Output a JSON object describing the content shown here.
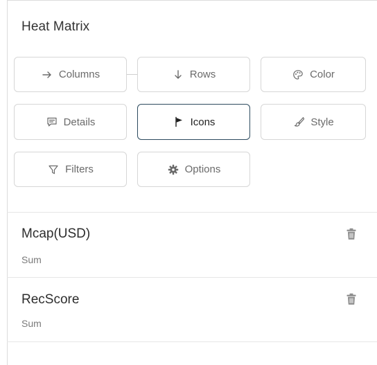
{
  "panel": {
    "title": "Heat Matrix"
  },
  "buttons": {
    "columns": {
      "label": "Columns",
      "icon": "arrow-right-icon"
    },
    "rows": {
      "label": "Rows",
      "icon": "arrow-down-icon"
    },
    "color": {
      "label": "Color",
      "icon": "palette-icon"
    },
    "details": {
      "label": "Details",
      "icon": "comment-icon"
    },
    "icons": {
      "label": "Icons",
      "icon": "flag-icon",
      "active": true
    },
    "style": {
      "label": "Style",
      "icon": "paint-brush-icon"
    },
    "filters": {
      "label": "Filters",
      "icon": "filter-icon"
    },
    "options": {
      "label": "Options",
      "icon": "gear-icon"
    }
  },
  "measures": [
    {
      "name": "Mcap(USD)",
      "aggregation": "Sum"
    },
    {
      "name": "RecScore",
      "aggregation": "Sum"
    }
  ],
  "colors": {
    "active_border": "#2c4a5e",
    "border": "#d6d6d6",
    "text": "#333333",
    "muted": "#7a7a7a"
  }
}
